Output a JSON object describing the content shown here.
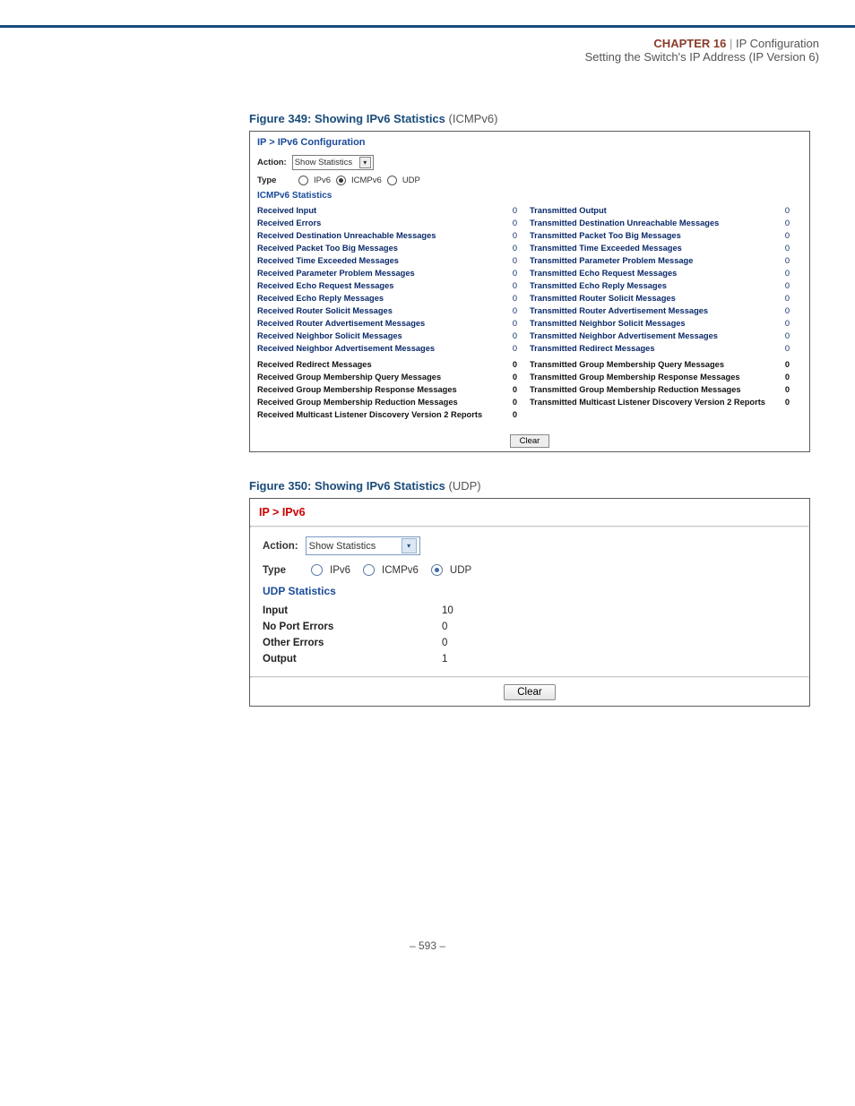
{
  "header": {
    "chapter_word_caps": "CHAPTER",
    "chapter_num": "16",
    "divider": "|",
    "title": "IP Configuration",
    "subtitle": "Setting the Switch's IP Address (IP Version 6)"
  },
  "fig349": {
    "label": "Figure 349:  Showing IPv6 Statistics",
    "suffix": " (ICMPv6)"
  },
  "panelA": {
    "breadcrumb": "IP > IPv6 Configuration",
    "action_label": "Action:",
    "action_value": "Show Statistics",
    "type_label": "Type",
    "types": {
      "ipv6": "IPv6",
      "icmpv6": "ICMPv6",
      "udp": "UDP"
    },
    "section_title": "ICMPv6 Statistics",
    "left_top": [
      {
        "k": "Received Input",
        "v": "0"
      },
      {
        "k": "Received Errors",
        "v": "0"
      },
      {
        "k": "Received Destination Unreachable Messages",
        "v": "0"
      },
      {
        "k": "Received Packet Too Big Messages",
        "v": "0"
      },
      {
        "k": "Received Time Exceeded Messages",
        "v": "0"
      },
      {
        "k": "Received Parameter Problem Messages",
        "v": "0"
      },
      {
        "k": "Received Echo Request Messages",
        "v": "0"
      },
      {
        "k": "Received Echo Reply Messages",
        "v": "0"
      },
      {
        "k": "Received Router Solicit Messages",
        "v": "0"
      },
      {
        "k": "Received Router Advertisement Messages",
        "v": "0"
      },
      {
        "k": "Received Neighbor Solicit Messages",
        "v": "0"
      },
      {
        "k": "Received Neighbor Advertisement Messages",
        "v": "0"
      }
    ],
    "right_top": [
      {
        "k": "Transmitted Output",
        "v": "0"
      },
      {
        "k": "Transmitted Destination Unreachable Messages",
        "v": "0"
      },
      {
        "k": "Transmitted Packet Too Big Messages",
        "v": "0"
      },
      {
        "k": "Transmitted Time Exceeded Messages",
        "v": "0"
      },
      {
        "k": "Transmitted Parameter Problem Message",
        "v": "0"
      },
      {
        "k": "Transmitted Echo Request Messages",
        "v": "0"
      },
      {
        "k": "Transmitted Echo Reply Messages",
        "v": "0"
      },
      {
        "k": "Transmitted Router Solicit Messages",
        "v": "0"
      },
      {
        "k": "Transmitted Router Advertisement Messages",
        "v": "0"
      },
      {
        "k": "Transmitted Neighbor Solicit Messages",
        "v": "0"
      },
      {
        "k": "Transmitted Neighbor Advertisement Messages",
        "v": "0"
      },
      {
        "k": "Transmitted Redirect Messages",
        "v": "0"
      }
    ],
    "left_bottom": [
      {
        "k": "Received Redirect Messages",
        "v": "0"
      },
      {
        "k": "Received Group Membership Query Messages",
        "v": "0"
      },
      {
        "k": "Received Group Membership Response Messages",
        "v": "0"
      },
      {
        "k": "Received Group Membership Reduction Messages",
        "v": "0"
      },
      {
        "k": "Received Multicast Listener Discovery Version 2 Reports",
        "v": "0"
      }
    ],
    "right_bottom": [
      {
        "k": "Transmitted Group Membership Query Messages",
        "v": "0"
      },
      {
        "k": "Transmitted Group Membership Response Messages",
        "v": "0"
      },
      {
        "k": "Transmitted Group Membership Reduction Messages",
        "v": "0"
      },
      {
        "k": "Transmitted Multicast Listener Discovery Version 2 Reports",
        "v": "0"
      }
    ],
    "clear_btn": "Clear"
  },
  "fig350": {
    "label": "Figure 350:  Showing IPv6 Statistics",
    "suffix": " (UDP)"
  },
  "panelB": {
    "breadcrumb": "IP > IPv6",
    "action_label": "Action:",
    "action_value": "Show Statistics",
    "type_label": "Type",
    "types": {
      "ipv6": "IPv6",
      "icmpv6": "ICMPv6",
      "udp": "UDP"
    },
    "section_title": "UDP Statistics",
    "stats": [
      {
        "k": "Input",
        "v": "10"
      },
      {
        "k": "No Port Errors",
        "v": "0"
      },
      {
        "k": "Other Errors",
        "v": "0"
      },
      {
        "k": "Output",
        "v": "1"
      }
    ],
    "clear_btn": "Clear"
  },
  "footer": {
    "page": "– 593 –"
  }
}
